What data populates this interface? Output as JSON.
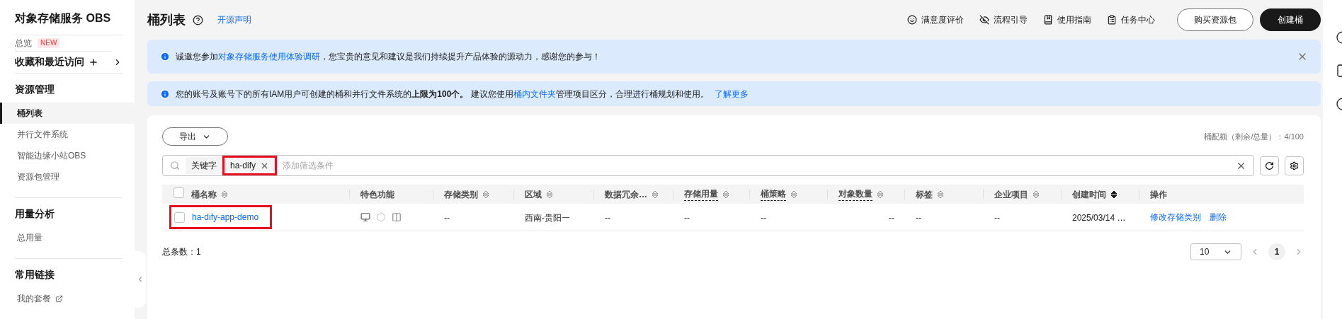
{
  "sidebar": {
    "title": "对象存储服务 OBS",
    "overview": {
      "label": "总览",
      "badge": "NEW"
    },
    "favorites": {
      "label": "收藏和最近访问"
    },
    "sections": [
      {
        "title": "资源管理",
        "items": [
          {
            "label": "桶列表",
            "selected": true
          },
          {
            "label": "并行文件系统",
            "selected": false
          },
          {
            "label": "智能边缘小站OBS",
            "selected": false
          },
          {
            "label": "资源包管理",
            "selected": false
          }
        ]
      },
      {
        "title": "用量分析",
        "items": [
          {
            "label": "总用量",
            "selected": false
          }
        ]
      },
      {
        "title": "常用链接",
        "items": [
          {
            "label": "我的套餐",
            "selected": false,
            "external": true
          }
        ]
      }
    ]
  },
  "header": {
    "title": "桶列表",
    "link": "开源声明",
    "actions": [
      {
        "label": "满意度评价"
      },
      {
        "label": "流程引导"
      },
      {
        "label": "使用指南"
      },
      {
        "label": "任务中心"
      }
    ],
    "buttons": [
      {
        "label": "购买资源包",
        "kind": "outline"
      },
      {
        "label": "创建桶",
        "kind": "primary"
      }
    ]
  },
  "banners": [
    {
      "closable": true,
      "segments": [
        {
          "kind": "plain",
          "text": "诚邀您参加"
        },
        {
          "kind": "link",
          "text": "对象存储服务使用体验调研"
        },
        {
          "kind": "plain",
          "text": "，您宝贵的意见和建议是我们持续提升产品体验的源动力，感谢您的参与！"
        }
      ]
    },
    {
      "closable": false,
      "segments": [
        {
          "kind": "plain",
          "text": "您的账号及账号下的所有IAM用户可创建的桶和并行文件系统的**上限为100个。** 建议您使用"
        },
        {
          "kind": "link",
          "text": "桶内文件夹"
        },
        {
          "kind": "plain",
          "text": "管理项目区分，合理进行桶规划和使用。"
        },
        {
          "kind": "link",
          "text": "了解更多"
        }
      ]
    }
  ],
  "card": {
    "export_button": "导出",
    "quota": "桶配额（剩余/总量）：4/100",
    "search": {
      "tags": [
        {
          "key": "关键字",
          "value": "ha-dify",
          "highlighted": true
        }
      ],
      "placeholder": "添加筛选条件"
    },
    "table": {
      "all_selected": false,
      "columns": [
        {
          "label": "桶名称",
          "sortable": true,
          "sort_active": false,
          "underlined": false
        },
        {
          "label": "特色功能",
          "sortable": false,
          "underlined": false
        },
        {
          "label": "存储类别",
          "sortable": true,
          "sort_active": false,
          "underlined": false
        },
        {
          "label": "区域",
          "sortable": true,
          "sort_active": false,
          "underlined": false
        },
        {
          "label": "数据冗余…",
          "sortable": true,
          "sort_active": false,
          "underlined": false
        },
        {
          "label": "存储用量",
          "sortable": true,
          "sort_active": false,
          "underlined": true
        },
        {
          "label": "桶策略",
          "sortable": true,
          "sort_active": false,
          "underlined": true
        },
        {
          "label": "对象数量",
          "sortable": true,
          "sort_active": false,
          "underlined": true
        },
        {
          "label": "标签",
          "sortable": true,
          "sort_active": false,
          "underlined": false
        },
        {
          "label": "企业项目",
          "sortable": true,
          "sort_active": false,
          "underlined": false
        },
        {
          "label": "创建时间",
          "sortable": true,
          "sort_active": true,
          "underlined": false
        },
        {
          "label": "操作",
          "sortable": false,
          "underlined": false
        }
      ],
      "rows": [
        {
          "selected": false,
          "highlighted": true,
          "name": "ha-dify-app-demo",
          "storage_class": "--",
          "region": "西南-贵阳一",
          "redundancy": "--",
          "usage": "--",
          "policy": "--",
          "objects": "--",
          "tags": "--",
          "project": "--",
          "created": "2025/03/14 …",
          "operations": [
            "修改存储类别",
            "删除"
          ]
        }
      ]
    },
    "total": "总条数：1",
    "pagination": {
      "page_size": "10",
      "pages": [
        {
          "label": "1",
          "selected": true
        }
      ]
    }
  }
}
